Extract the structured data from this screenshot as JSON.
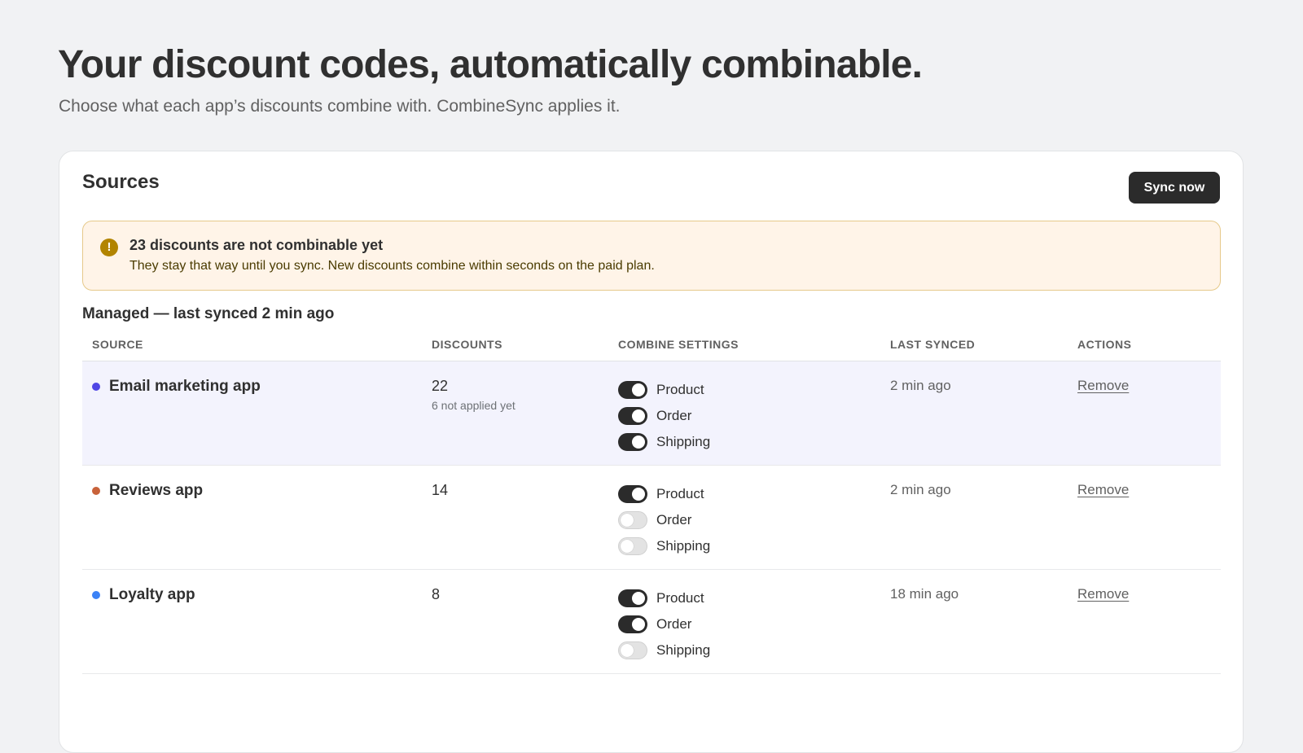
{
  "header": {
    "title": "Your discount codes, automatically combinable.",
    "subtitle": "Choose what each app’s discounts combine with. CombineSync applies it."
  },
  "sources_card": {
    "title": "Sources",
    "sync_button_label": "Sync now",
    "banner": {
      "icon": "warning-icon",
      "icon_glyph": "!",
      "title": "23 discounts are not combinable yet",
      "text": "They stay that way until you sync. New discounts combine within seconds on the paid plan."
    },
    "section_label": "Managed — last synced 2 min ago",
    "columns": {
      "source": "SOURCE",
      "discounts": "DISCOUNTS",
      "combine": "COMBINE SETTINGS",
      "last_synced": "LAST SYNCED",
      "actions": "ACTIONS"
    },
    "rows": [
      {
        "name": "Email marketing app",
        "dot_color": "#4f46e5",
        "discounts": "22",
        "discounts_note": "6 not applied yet",
        "settings": [
          {
            "label": "Product",
            "on": true
          },
          {
            "label": "Order",
            "on": true
          },
          {
            "label": "Shipping",
            "on": true
          }
        ],
        "last_synced": "2 min ago",
        "action": "Remove"
      },
      {
        "name": "Reviews app",
        "dot_color": "#c8623a",
        "discounts": "14",
        "discounts_note": "",
        "settings": [
          {
            "label": "Product",
            "on": true
          },
          {
            "label": "Order",
            "on": false
          },
          {
            "label": "Shipping",
            "on": false
          }
        ],
        "last_synced": "2 min ago",
        "action": "Remove"
      },
      {
        "name": "Loyalty app",
        "dot_color": "#3b82f6",
        "discounts": "8",
        "discounts_note": "",
        "settings": [
          {
            "label": "Product",
            "on": true
          },
          {
            "label": "Order",
            "on": true
          },
          {
            "label": "Shipping",
            "on": false
          }
        ],
        "last_synced": "18 min ago",
        "action": "Remove"
      }
    ]
  },
  "colors": {
    "background": "#f1f2f4",
    "primary_button": "#2b2b2b",
    "banner_bg": "#fff4e8",
    "banner_border": "#e6c98a",
    "warning_icon": "#b28400",
    "highlight_row": "#f3f3fd"
  }
}
